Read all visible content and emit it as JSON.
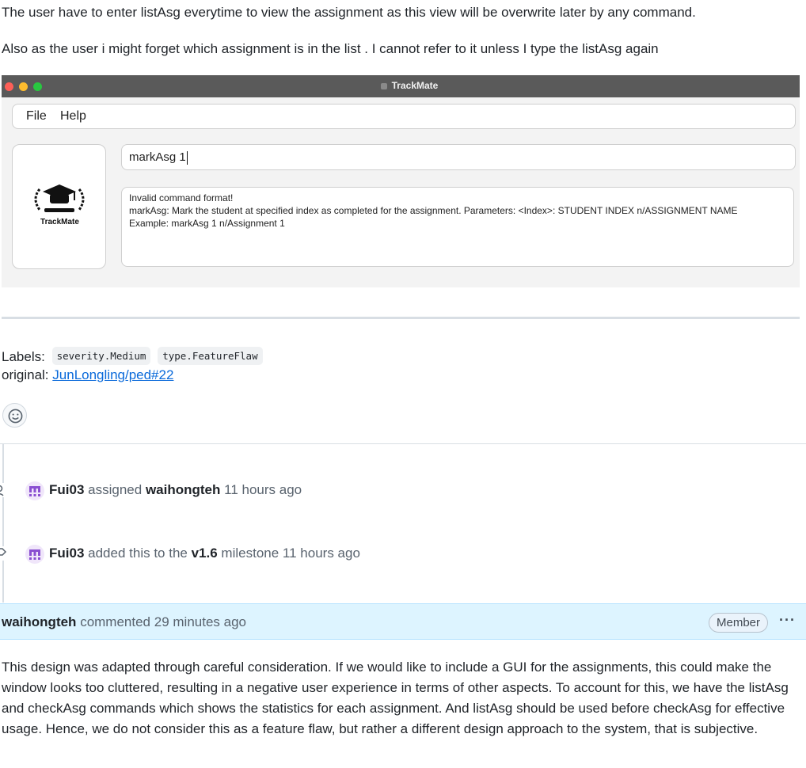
{
  "description": {
    "line1": "The user have to enter listAsg everytime to view the assignment as this view will be overwrite later by any command.",
    "line2": "Also as the user i might forget which assignment is in the list . I cannot refer to it unless I type the listAsg again"
  },
  "app": {
    "window_title": "TrackMate",
    "menu": [
      "File",
      "Help"
    ],
    "logo_text": "TrackMate",
    "command_value": "markAsg 1",
    "result_lines": [
      "Invalid command format!",
      "markAsg: Mark the student at specified index as completed for the assignment. Parameters: <Index>: STUDENT INDEX n/ASSIGNMENT NAME",
      "Example: markAsg 1 n/Assignment 1"
    ]
  },
  "labels": {
    "prefix": "Labels:",
    "items": [
      "severity.Medium",
      "type.FeatureFlaw"
    ]
  },
  "original": {
    "prefix": "original:",
    "link_text": "JunLongling/ped#22"
  },
  "timeline": [
    {
      "actor": "Fui03",
      "verb": "assigned",
      "target": "waihongteh",
      "suffix": "",
      "time": "11 hours ago"
    },
    {
      "actor": "Fui03",
      "verb": "added this to the",
      "target": "v1.6",
      "suffix": "milestone",
      "time": "11 hours ago"
    }
  ],
  "comment": {
    "author": "waihongteh",
    "action": "commented",
    "time": "29 minutes ago",
    "badge": "Member",
    "menu_glyph": "···",
    "body": "This design was adapted through careful consideration. If we would like to include a GUI for the assignments, this could make the window looks too cluttered, resulting in a negative user experience in terms of other aspects. To account for this, we have the listAsg and checkAsg commands which shows the statistics for each assignment. And listAsg should be used before checkAsg for effective usage. Hence, we do not consider this as a feature flaw, but rather a different design approach to the system, that is subjective."
  },
  "icons": {
    "emoji": "smiley-icon",
    "assign": "person-icon",
    "milestone": "milestone-icon"
  },
  "colors": {
    "link": "#0969da",
    "comment_header_bg": "#ddf4ff",
    "titlebar": "#5a5a5a"
  }
}
